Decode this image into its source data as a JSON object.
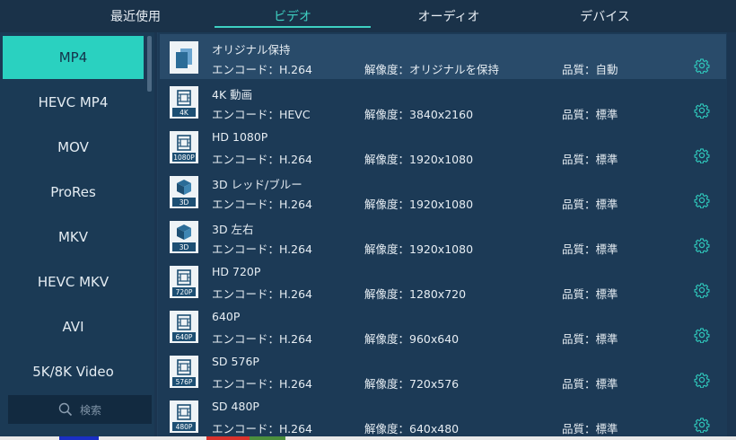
{
  "tabs": [
    {
      "label": "最近使用",
      "active": false
    },
    {
      "label": "ビデオ",
      "active": true
    },
    {
      "label": "オーディオ",
      "active": false
    },
    {
      "label": "デバイス",
      "active": false
    }
  ],
  "sidebar": {
    "items": [
      {
        "label": "MP4",
        "active": true
      },
      {
        "label": "HEVC MP4"
      },
      {
        "label": "MOV"
      },
      {
        "label": "ProRes"
      },
      {
        "label": "MKV"
      },
      {
        "label": "HEVC MKV"
      },
      {
        "label": "AVI"
      },
      {
        "label": "5K/8K Video"
      }
    ],
    "search_placeholder": "検索"
  },
  "presets": [
    {
      "name": "オリジナル保持",
      "icon": "original-icon",
      "badge": "",
      "encode": "エンコード：H.264",
      "resolution": "解像度：オリジナルを保持",
      "quality": "品質：自動"
    },
    {
      "name": "4K 動画",
      "icon": "film-icon",
      "badge": "4K",
      "encode": "エンコード：HEVC",
      "resolution": "解像度：3840x2160",
      "quality": "品質：標準"
    },
    {
      "name": "HD 1080P",
      "icon": "film-icon",
      "badge": "1080P",
      "encode": "エンコード：H.264",
      "resolution": "解像度：1920x1080",
      "quality": "品質：標準"
    },
    {
      "name": "3D レッド/ブルー",
      "icon": "cube-icon",
      "badge": "3D",
      "encode": "エンコード：H.264",
      "resolution": "解像度：1920x1080",
      "quality": "品質：標準"
    },
    {
      "name": "3D 左右",
      "icon": "cube-icon",
      "badge": "3D",
      "encode": "エンコード：H.264",
      "resolution": "解像度：1920x1080",
      "quality": "品質：標準"
    },
    {
      "name": "HD 720P",
      "icon": "film-icon",
      "badge": "720P",
      "encode": "エンコード：H.264",
      "resolution": "解像度：1280x720",
      "quality": "品質：標準"
    },
    {
      "name": "640P",
      "icon": "film-icon",
      "badge": "640P",
      "encode": "エンコード：H.264",
      "resolution": "解像度：960x640",
      "quality": "品質：標準"
    },
    {
      "name": "SD 576P",
      "icon": "film-icon",
      "badge": "576P",
      "encode": "エンコード：H.264",
      "resolution": "解像度：720x576",
      "quality": "品質：標準"
    },
    {
      "name": "SD 480P",
      "icon": "film-icon",
      "badge": "480P",
      "encode": "エンコード：H.264",
      "resolution": "解像度：640x480",
      "quality": "品質：標準"
    }
  ],
  "colors": {
    "accent": "#2ad1c0",
    "background": "#1b3550",
    "selected_row": "#294b6a"
  }
}
